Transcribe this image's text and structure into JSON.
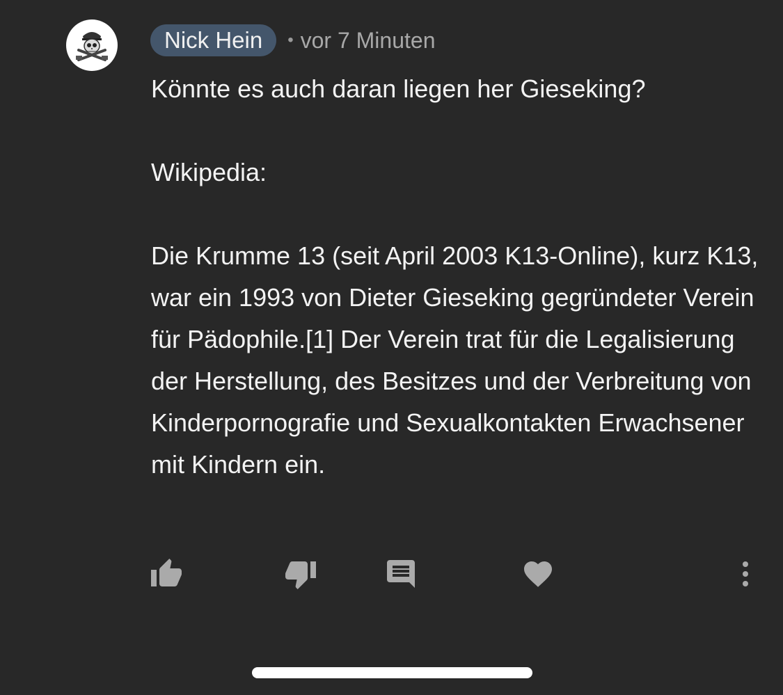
{
  "comment": {
    "author": "Nick Hein",
    "separator": "•",
    "timestamp": "vor 7 Minuten",
    "paragraphs": [
      "Könnte es auch daran liegen her Gieseking?",
      "Wikipedia:",
      "Die Krumme 13 (seit April 2003 K13-Online), kurz K13, war ein 1993 von Dieter Gieseking gegründeter Verein für Pädophile.[1] Der Verein trat für die Legalisierung der Herstellung, des Besitzes und der Verbreitung von Kinderpornografie und Sexualkontakten Erwachsener mit Kindern ein."
    ]
  },
  "actions": {
    "icons": [
      "thumbs-up-icon",
      "thumbs-down-icon",
      "reply-icon",
      "heart-icon",
      "more-vertical-icon"
    ]
  },
  "colors": {
    "background": "#282828",
    "author_chip": "#44566b",
    "icon": "#aaaaaa",
    "text": "#f3f3f3",
    "muted_text": "#a8a8a8"
  }
}
